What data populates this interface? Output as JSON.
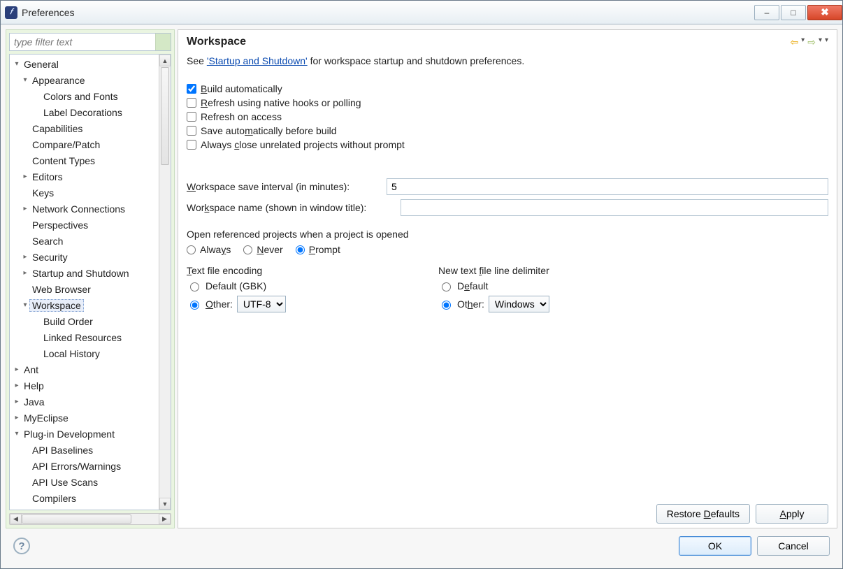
{
  "window": {
    "title": "Preferences"
  },
  "filter": {
    "placeholder": "type filter text"
  },
  "tree": {
    "general": {
      "label": "General",
      "appearance": {
        "label": "Appearance",
        "colors_fonts": "Colors and Fonts",
        "label_decorations": "Label Decorations"
      },
      "capabilities": "Capabilities",
      "compare_patch": "Compare/Patch",
      "content_types": "Content Types",
      "editors": "Editors",
      "keys": "Keys",
      "network_connections": "Network Connections",
      "perspectives": "Perspectives",
      "search": "Search",
      "security": "Security",
      "startup_shutdown": "Startup and Shutdown",
      "web_browser": "Web Browser",
      "workspace": {
        "label": "Workspace",
        "build_order": "Build Order",
        "linked_resources": "Linked Resources",
        "local_history": "Local History"
      }
    },
    "ant": "Ant",
    "help": "Help",
    "java": "Java",
    "myeclipse": "MyEclipse",
    "plugin_dev": {
      "label": "Plug-in Development",
      "api_baselines": "API Baselines",
      "api_errors": "API Errors/Warnings",
      "api_use_scans": "API Use Scans",
      "compilers": "Compilers"
    }
  },
  "page": {
    "title": "Workspace",
    "intro_prefix": "See ",
    "intro_link": "'Startup and Shutdown'",
    "intro_suffix": " for workspace startup and shutdown preferences.",
    "checks": {
      "build_auto": "Build automatically",
      "refresh_native": "Refresh using native hooks or polling",
      "refresh_access": "Refresh on access",
      "save_before_build": "Save automatically before build",
      "close_unrelated": "Always close unrelated projects without prompt"
    },
    "save_interval_label": "Workspace save interval (in minutes):",
    "save_interval_value": "5",
    "workspace_name_label": "Workspace name (shown in window title):",
    "workspace_name_value": "",
    "open_ref": {
      "title": "Open referenced projects when a project is opened",
      "always": "Always",
      "never": "Never",
      "prompt": "Prompt"
    },
    "encoding": {
      "title": "Text file encoding",
      "default_label": "Default (GBK)",
      "other_label": "Other:",
      "other_value": "UTF-8"
    },
    "delimiter": {
      "title": "New text file line delimiter",
      "default_label": "Default",
      "other_label": "Other:",
      "other_value": "Windows"
    }
  },
  "buttons": {
    "restore_defaults": "Restore Defaults",
    "apply": "Apply",
    "ok": "OK",
    "cancel": "Cancel"
  }
}
